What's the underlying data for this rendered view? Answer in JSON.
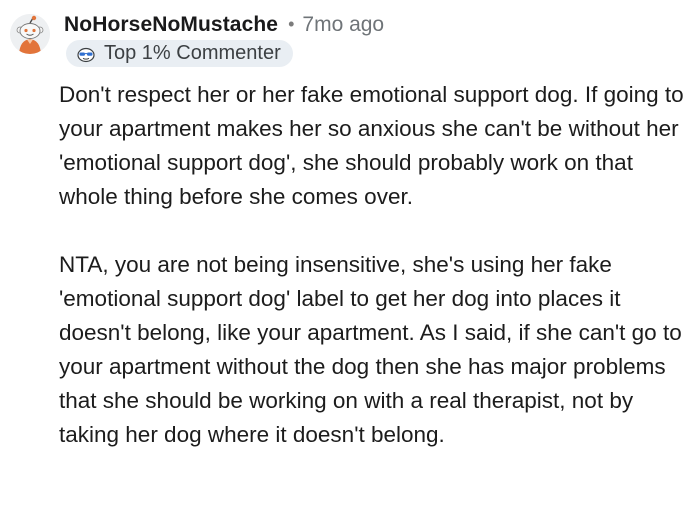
{
  "comment": {
    "username": "NoHorseNoMustache",
    "separator": "•",
    "timestamp": "7mo ago",
    "badge": {
      "label": "Top 1% Commenter",
      "icon": "sunglasses-snoo-icon"
    },
    "avatar_icon": "snoo-avatar-icon",
    "paragraphs": [
      "Don't respect her or her fake emotional support dog. If going to your apartment makes her so anxious she can't be without her 'emotional support dog', she should probably work on that whole thing before she comes over.",
      "NTA, you are not being insensitive, she's using her fake 'emotional support dog' label to get her dog into places it doesn't belong, like your apartment. As I said, if she can't go to your apartment without the dog then she has major problems that she should be working on with a real therapist, not by taking her dog where it doesn't belong."
    ]
  },
  "colors": {
    "text": "#1c1c1c",
    "meta": "#6f7478",
    "badge_bg": "#e9eef3",
    "avatar_orange": "#e2743a"
  }
}
